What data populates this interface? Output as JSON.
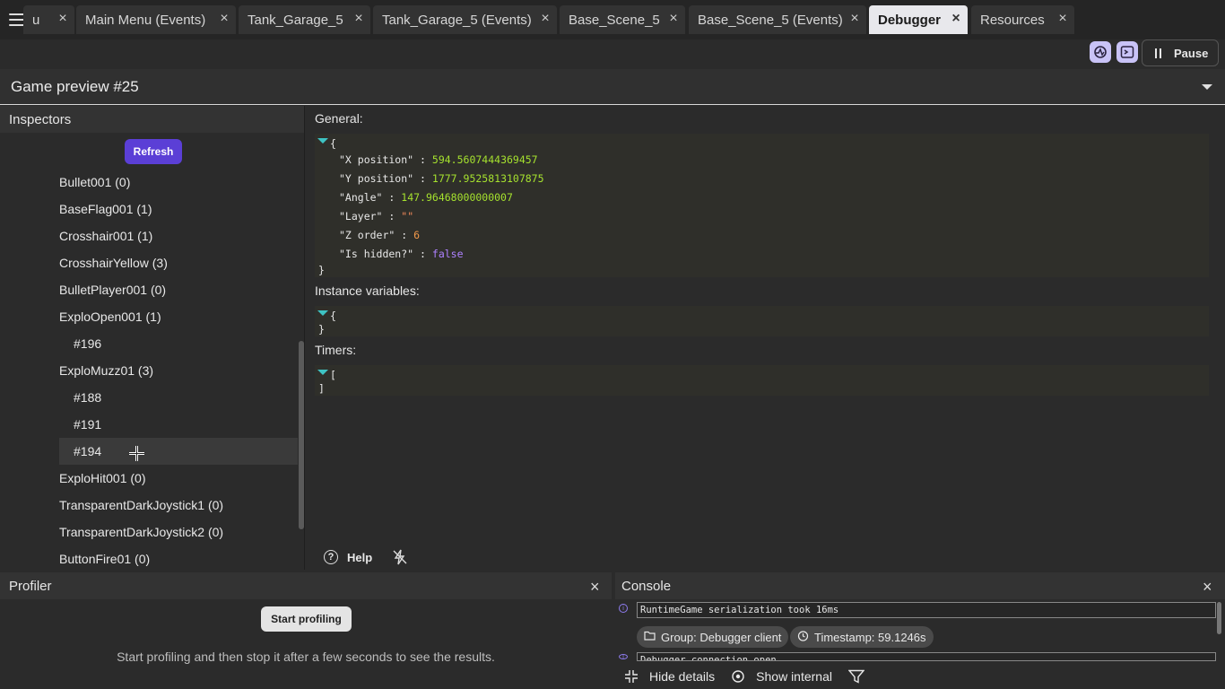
{
  "tabs": [
    {
      "label": "u"
    },
    {
      "label": "Main Menu (Events)"
    },
    {
      "label": "Tank_Garage_5"
    },
    {
      "label": "Tank_Garage_5 (Events)"
    },
    {
      "label": "Base_Scene_5"
    },
    {
      "label": "Base_Scene_5 (Events)"
    },
    {
      "label": "Debugger"
    },
    {
      "label": "Resources"
    }
  ],
  "toolbar": {
    "pause_label": "Pause"
  },
  "preview": {
    "title": "Game preview #25"
  },
  "inspectors": {
    "title": "Inspectors",
    "refresh_label": "Refresh",
    "items": [
      {
        "label": "Bullet001 (0)",
        "level": 1
      },
      {
        "label": "BaseFlag001 (1)",
        "level": 1
      },
      {
        "label": "Crosshair001 (1)",
        "level": 1
      },
      {
        "label": "CrosshairYellow (3)",
        "level": 1
      },
      {
        "label": "BulletPlayer001 (0)",
        "level": 1
      },
      {
        "label": "ExploOpen001 (1)",
        "level": 1
      },
      {
        "label": "#196",
        "level": 2
      },
      {
        "label": "ExploMuzz01 (3)",
        "level": 1
      },
      {
        "label": "#188",
        "level": 2
      },
      {
        "label": "#191",
        "level": 2
      },
      {
        "label": "#194",
        "level": 2,
        "selected": true
      },
      {
        "label": "ExploHit001 (0)",
        "level": 1
      },
      {
        "label": "TransparentDarkJoystick1 (0)",
        "level": 1
      },
      {
        "label": "TransparentDarkJoystick2 (0)",
        "level": 1
      },
      {
        "label": "ButtonFire01 (0)",
        "level": 1
      }
    ]
  },
  "general": {
    "label": "General:",
    "open": "{",
    "close": "}",
    "fields": [
      {
        "key": "\"X position\"",
        "sep": ":",
        "value": "594.5607444369457",
        "type": "num"
      },
      {
        "key": "\"Y position\"",
        "sep": ":",
        "value": "1777.9525813107875",
        "type": "num"
      },
      {
        "key": "\"Angle\"",
        "sep": ":",
        "value": "147.96468000000007",
        "type": "num"
      },
      {
        "key": "\"Layer\"",
        "sep": ":",
        "value": "\"\"",
        "type": "str"
      },
      {
        "key": "\"Z order\"",
        "sep": ":",
        "value": "6",
        "type": "zorder"
      },
      {
        "key": "\"Is hidden?\"",
        "sep": ":",
        "value": "false",
        "type": "bool"
      }
    ]
  },
  "instance_variables": {
    "label": "Instance variables:",
    "open": "{",
    "close": "}"
  },
  "timers": {
    "label": "Timers:",
    "open": "[",
    "close": "]"
  },
  "help": {
    "label": "Help"
  },
  "profiler": {
    "title": "Profiler",
    "start_label": "Start profiling",
    "hint": "Start profiling and then stop it after a few seconds to see the results."
  },
  "console": {
    "title": "Console",
    "log1": "RuntimeGame serialization took 16ms",
    "log2": "Debugger connection open",
    "group_chip": "Group: Debugger client",
    "timestamp_chip": "Timestamp: 59.1246s",
    "hide_details": "Hide details",
    "show_internal": "Show internal"
  },
  "colors": {
    "accent": "#5b3fd6",
    "json_number": "#a6e22e",
    "json_bool": "#ae81ff",
    "json_tri": "#3ec3c3"
  }
}
